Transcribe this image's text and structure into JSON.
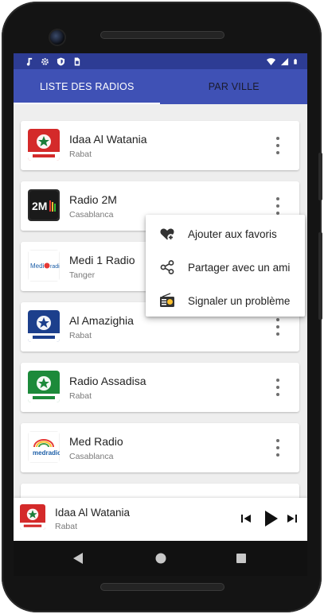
{
  "status_bar": {
    "left_icons": [
      "music-note-icon",
      "settings-gear-icon",
      "shield-icon",
      "sim-card-icon"
    ],
    "right_icons": [
      "wifi-icon",
      "cell-signal-icon",
      "battery-icon"
    ]
  },
  "tabs": [
    {
      "label": "LISTE DES RADIOS",
      "active": true
    },
    {
      "label": "PAR VILLE",
      "active": false
    }
  ],
  "stations": [
    {
      "name": "Idaa Al Watania",
      "city": "Rabat",
      "logo": "snrt-red-logo"
    },
    {
      "name": "Radio 2M",
      "city": "Casablanca",
      "logo": "2m-logo"
    },
    {
      "name": "Medi 1 Radio",
      "city": "Tanger",
      "logo": "medi1-logo"
    },
    {
      "name": "Al Amazighia",
      "city": "Rabat",
      "logo": "snrt-blue-logo"
    },
    {
      "name": "Radio Assadisa",
      "city": "Rabat",
      "logo": "snrt-green-logo"
    },
    {
      "name": "Med Radio",
      "city": "Casablanca",
      "logo": "medradio-logo"
    }
  ],
  "popup_menu": {
    "items": [
      {
        "label": "Ajouter aux favoris",
        "icon": "heart-plus-icon"
      },
      {
        "label": "Partager avec un ami",
        "icon": "share-icon"
      },
      {
        "label": "Signaler un problème",
        "icon": "report-radio-icon"
      }
    ]
  },
  "player": {
    "name": "Idaa Al Watania",
    "city": "Rabat",
    "controls": [
      "skip-previous-icon",
      "play-icon",
      "skip-next-icon"
    ]
  },
  "nav_bar": [
    "back-icon",
    "home-icon",
    "recents-icon"
  ],
  "colors": {
    "status_bar": "#2d3c94",
    "tab_bar": "#3f51b5",
    "snrt_red": "#d42a2a",
    "snrt_blue": "#1c3f8c",
    "snrt_green": "#1c8a3a"
  }
}
